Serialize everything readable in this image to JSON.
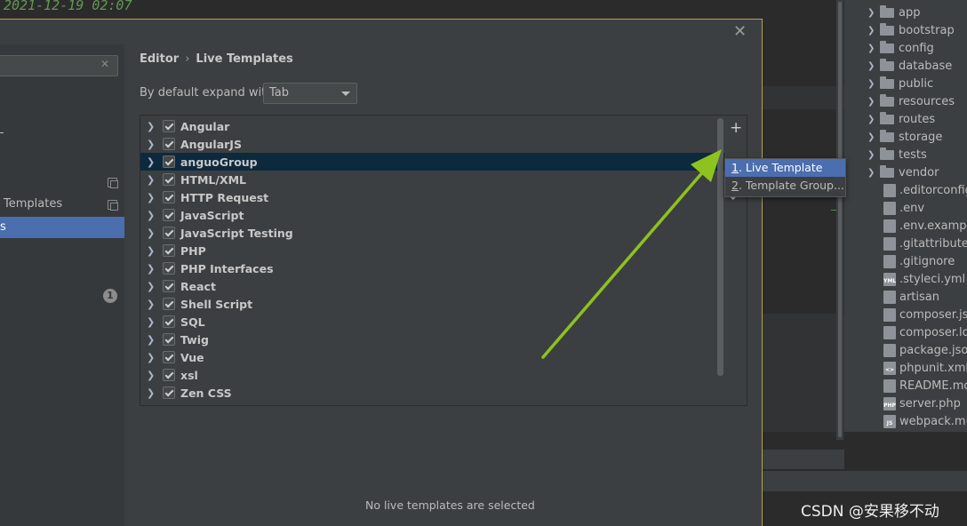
{
  "background": {
    "timestamp": "2021-12-19 02:07"
  },
  "project_tree": {
    "folders": [
      "app",
      "bootstrap",
      "config",
      "database",
      "public",
      "resources",
      "routes",
      "storage",
      "tests",
      "vendor"
    ],
    "files": [
      {
        "name": ".editorconfig",
        "icon": "gear-icon"
      },
      {
        "name": ".env",
        "icon": "file-icon"
      },
      {
        "name": ".env.example",
        "icon": "file-icon"
      },
      {
        "name": ".gitattributes",
        "icon": "file-icon"
      },
      {
        "name": ".gitignore",
        "icon": "file-icon"
      },
      {
        "name": ".styleci.yml",
        "icon": "yml-file-icon",
        "badge": "YML"
      },
      {
        "name": "artisan",
        "icon": "file-icon"
      },
      {
        "name": "composer.jso",
        "icon": "json-file-icon"
      },
      {
        "name": "composer.loc",
        "icon": "file-icon"
      },
      {
        "name": "package.json",
        "icon": "json-file-icon"
      },
      {
        "name": "phpunit.xml",
        "icon": "xml-file-icon",
        "badge": "<>"
      },
      {
        "name": "README.md",
        "icon": "md-file-icon"
      },
      {
        "name": "server.php",
        "icon": "php-file-icon",
        "badge": "PHP"
      },
      {
        "name": "webpack.mix",
        "icon": "js-file-icon",
        "badge": "JS"
      }
    ]
  },
  "dialog": {
    "close_icon": "close-icon",
    "sidebar": {
      "templates_label": "Templates",
      "selected_label": "s",
      "badge_count": "1"
    },
    "breadcrumb": {
      "parent": "Editor",
      "separator": "›",
      "current": "Live Templates"
    },
    "expand_label": "By default expand with",
    "expand_value": "Tab",
    "templates": [
      {
        "name": "Angular",
        "checked": true
      },
      {
        "name": "AngularJS",
        "checked": true
      },
      {
        "name": "anguoGroup",
        "checked": true,
        "selected": true
      },
      {
        "name": "HTML/XML",
        "checked": true
      },
      {
        "name": "HTTP Request",
        "checked": true
      },
      {
        "name": "JavaScript",
        "checked": true
      },
      {
        "name": "JavaScript Testing",
        "checked": true
      },
      {
        "name": "PHP",
        "checked": true
      },
      {
        "name": "PHP Interfaces",
        "checked": true
      },
      {
        "name": "React",
        "checked": true
      },
      {
        "name": "Shell Script",
        "checked": true
      },
      {
        "name": "SQL",
        "checked": true
      },
      {
        "name": "Twig",
        "checked": true
      },
      {
        "name": "Vue",
        "checked": true
      },
      {
        "name": "xsl",
        "checked": true
      },
      {
        "name": "Zen CSS",
        "checked": true
      }
    ],
    "toolbar": {
      "add_icon": "plus-icon",
      "undo_icon": "undo-icon"
    },
    "popup": {
      "items": [
        {
          "mnemonic": "1",
          "label": ". Live Template"
        },
        {
          "mnemonic": "2",
          "label": ". Template Group..."
        }
      ]
    },
    "status": "No live templates are selected"
  },
  "watermark": "CSDN @安果移不动",
  "colors": {
    "selection": "#4b6eaf",
    "selected_row": "#0d293e",
    "arrow": "#8ec21f",
    "dialog_border": "#b0a15a"
  }
}
